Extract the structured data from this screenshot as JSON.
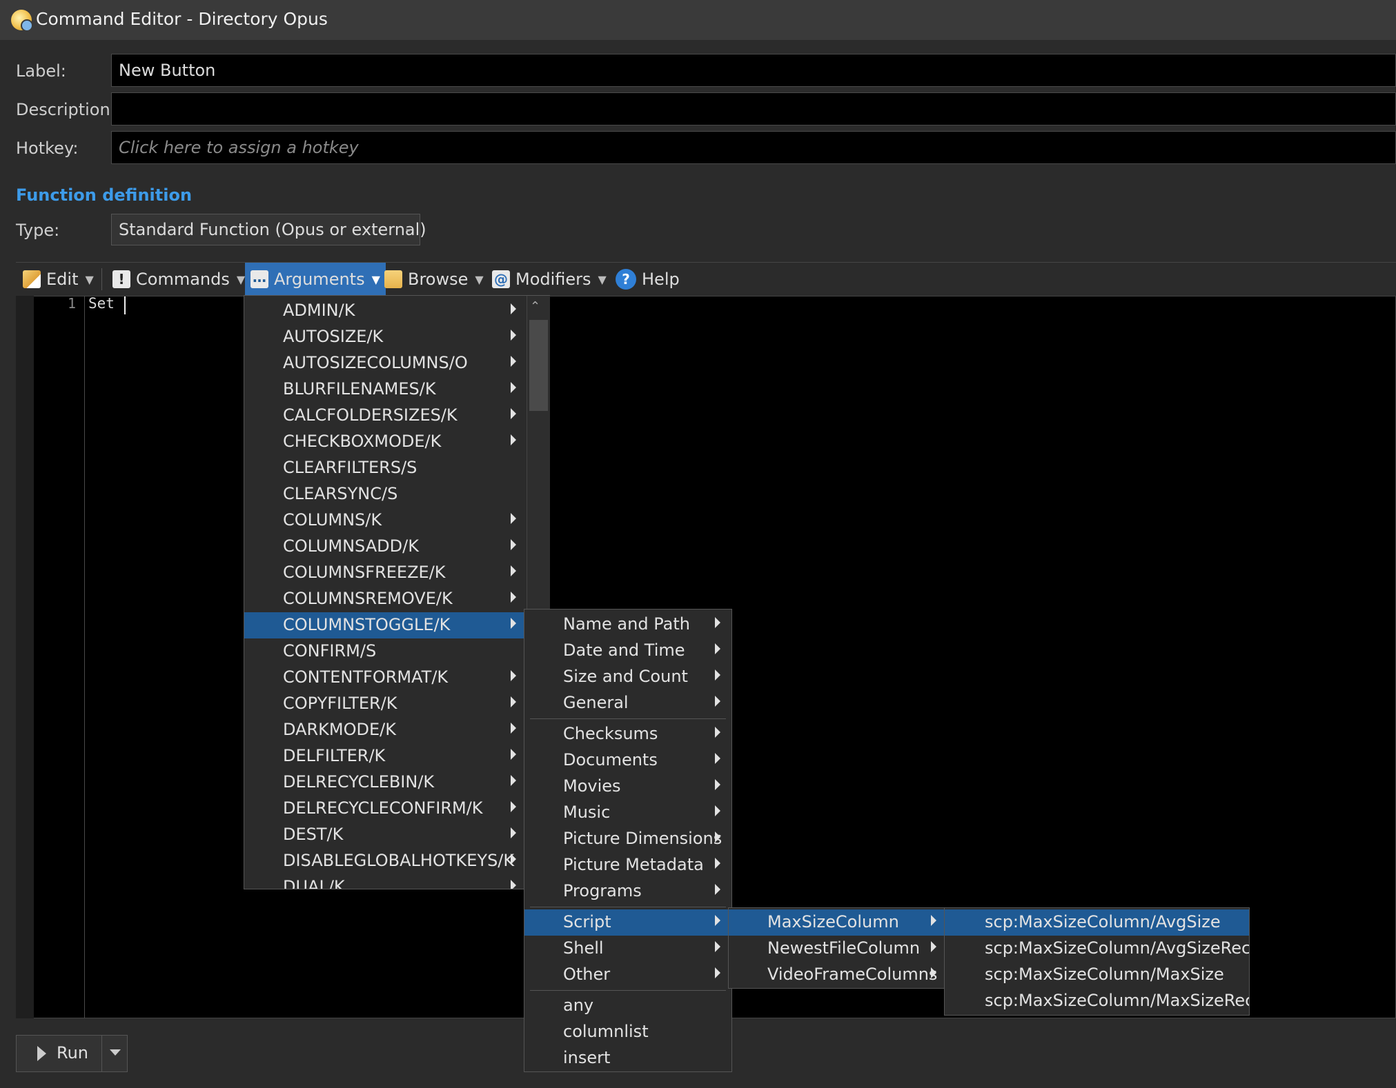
{
  "window": {
    "title": "Command Editor - Directory Opus"
  },
  "fields": {
    "label_label": "Label:",
    "label_value": "New Button",
    "description_label": "Description:",
    "description_value": "",
    "hotkey_label": "Hotkey:",
    "hotkey_placeholder": "Click here to assign a hotkey"
  },
  "function_definition": {
    "title": "Function definition",
    "type_label": "Type:",
    "type_value": "Standard Function (Opus or external)"
  },
  "toolbar": {
    "edit": "Edit",
    "commands": "Commands",
    "arguments": "Arguments",
    "browse": "Browse",
    "modifiers": "Modifiers",
    "help": "Help"
  },
  "editor": {
    "line_number": "1",
    "code": "Set "
  },
  "arguments_menu": {
    "items": [
      {
        "label": "ADMIN/K",
        "submenu": true
      },
      {
        "label": "AUTOSIZE/K",
        "submenu": true
      },
      {
        "label": "AUTOSIZECOLUMNS/O",
        "submenu": true
      },
      {
        "label": "BLURFILENAMES/K",
        "submenu": true
      },
      {
        "label": "CALCFOLDERSIZES/K",
        "submenu": true
      },
      {
        "label": "CHECKBOXMODE/K",
        "submenu": true
      },
      {
        "label": "CLEARFILTERS/S",
        "submenu": false
      },
      {
        "label": "CLEARSYNC/S",
        "submenu": false
      },
      {
        "label": "COLUMNS/K",
        "submenu": true
      },
      {
        "label": "COLUMNSADD/K",
        "submenu": true
      },
      {
        "label": "COLUMNSFREEZE/K",
        "submenu": true
      },
      {
        "label": "COLUMNSREMOVE/K",
        "submenu": true
      },
      {
        "label": "COLUMNSTOGGLE/K",
        "submenu": true,
        "selected": true
      },
      {
        "label": "CONFIRM/S",
        "submenu": false
      },
      {
        "label": "CONTENTFORMAT/K",
        "submenu": true
      },
      {
        "label": "COPYFILTER/K",
        "submenu": true
      },
      {
        "label": "DARKMODE/K",
        "submenu": true
      },
      {
        "label": "DELFILTER/K",
        "submenu": true
      },
      {
        "label": "DELRECYCLEBIN/K",
        "submenu": true
      },
      {
        "label": "DELRECYCLECONFIRM/K",
        "submenu": true
      },
      {
        "label": "DEST/K",
        "submenu": true
      },
      {
        "label": "DISABLEGLOBALHOTKEYS/K",
        "submenu": true
      },
      {
        "label": "DUAL/K",
        "submenu": true
      }
    ]
  },
  "columnstoggle_menu": {
    "groups": [
      [
        "Name and Path",
        "Date and Time",
        "Size and Count",
        "General"
      ],
      [
        "Checksums",
        "Documents",
        "Movies",
        "Music",
        "Picture Dimensions",
        "Picture Metadata",
        "Programs"
      ],
      [
        "Script",
        "Shell",
        "Other"
      ],
      [
        "any",
        "columnlist",
        "insert"
      ]
    ],
    "selected": "Script",
    "no_submenu": [
      "any",
      "columnlist",
      "insert"
    ]
  },
  "script_menu": {
    "items": [
      "MaxSizeColumn",
      "NewestFileColumn",
      "VideoFrameColumns"
    ],
    "selected": "MaxSizeColumn"
  },
  "maxsize_menu": {
    "items": [
      "scp:MaxSizeColumn/AvgSize",
      "scp:MaxSizeColumn/AvgSizeRec",
      "scp:MaxSizeColumn/MaxSize",
      "scp:MaxSizeColumn/MaxSizeRec"
    ],
    "selected": "scp:MaxSizeColumn/AvgSize"
  },
  "run": {
    "label": "Run"
  },
  "colors": {
    "accent": "#3d9be9",
    "selection": "#1f5a94",
    "toolbar_active": "#2f6fb6"
  }
}
